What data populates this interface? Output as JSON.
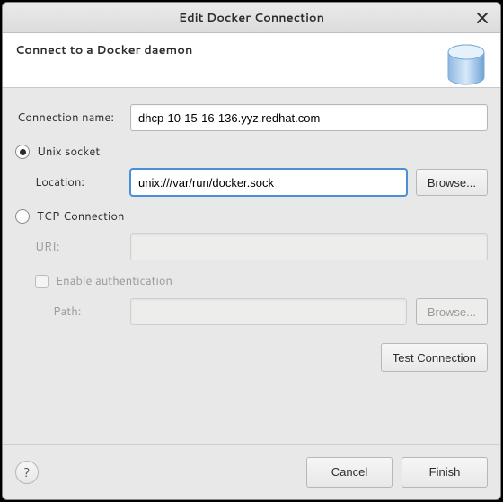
{
  "window": {
    "title": "Edit Docker Connection"
  },
  "header": {
    "text": "Connect to a Docker daemon"
  },
  "form": {
    "connection_name_label": "Connection name:",
    "connection_name_value": "dhcp-10-15-16-136.yyz.redhat.com",
    "unix_socket": {
      "label": "Unix socket",
      "selected": true,
      "location_label": "Location:",
      "location_value": "unix:///var/run/docker.sock",
      "browse_label": "Browse..."
    },
    "tcp": {
      "label": "TCP Connection",
      "selected": false,
      "uri_label": "URI:",
      "uri_value": "",
      "enable_auth_label": "Enable authentication",
      "enable_auth_checked": false,
      "path_label": "Path:",
      "path_value": "",
      "browse_label": "Browse..."
    },
    "test_connection_label": "Test Connection"
  },
  "footer": {
    "cancel_label": "Cancel",
    "finish_label": "Finish"
  }
}
